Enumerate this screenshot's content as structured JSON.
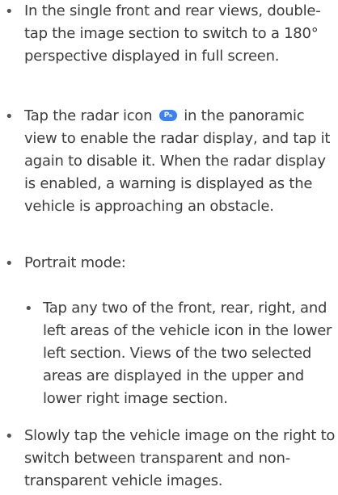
{
  "colors": {
    "text": "#3c3c3c",
    "radar_icon": "#3b82f6"
  },
  "items": [
    {
      "bullet": "•",
      "text": "In the single front and rear views, double-tap the image section to switch to a 180° perspective displayed in full screen."
    },
    {
      "bullet": "•",
      "text_before_icon": "Tap the radar icon",
      "icon": "radar-icon",
      "icon_glyph": "Pₕ",
      "text_after_icon": "in the panoramic view to enable the radar display, and tap it again to disable it. When the radar display is enabled, a warning is displayed as the vehicle is approaching an obstacle."
    },
    {
      "bullet": "•",
      "text": "Portrait mode:"
    },
    {
      "bullet": "•",
      "text": "Tap any two of the front, rear, right, and left areas of the vehicle icon in the lower left section. Views of the two selected areas are displayed in the upper and lower right image section."
    },
    {
      "bullet": "•",
      "text": "Slowly tap the vehicle image on the right to switch between transparent and non-transparent vehicle images."
    }
  ]
}
